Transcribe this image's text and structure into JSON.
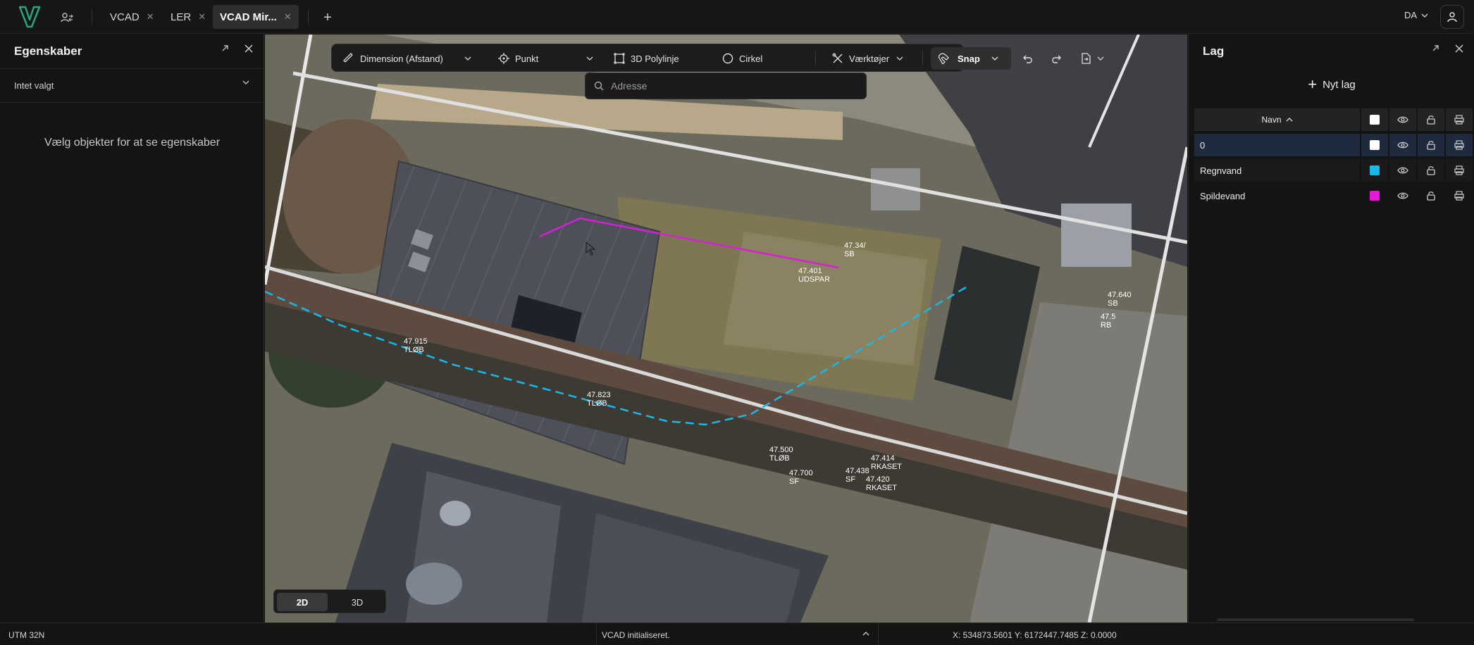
{
  "tabs": [
    {
      "label": "VCAD",
      "closable": true
    },
    {
      "label": "LER",
      "closable": true
    },
    {
      "label": "VCAD Mir...",
      "closable": true,
      "active": true
    }
  ],
  "language": "DA",
  "left_panel": {
    "title": "Egenskaber",
    "selection": "Intet valgt",
    "empty_message": "Vælg objekter for at se egenskaber"
  },
  "toolbar": {
    "dimension": "Dimension (Afstand)",
    "point": "Punkt",
    "polyline": "3D Polylinje",
    "circle": "Cirkel",
    "tools": "Værktøjer",
    "snap": "Snap"
  },
  "search": {
    "placeholder": "Adresse"
  },
  "view_toggle": {
    "btn_2d": "2D",
    "btn_3d": "3D",
    "active": "2D"
  },
  "map_labels": [
    {
      "value": "47.915",
      "code": "TLØB"
    },
    {
      "value": "47.823",
      "code": "TLØB"
    },
    {
      "value": "47.500",
      "code": "TLØB"
    },
    {
      "value": "47.700",
      "code": "SF"
    },
    {
      "value": "47.438",
      "code": "SF"
    },
    {
      "value": "47.414",
      "code": "RKASET"
    },
    {
      "value": "47.420",
      "code": "RKASET"
    },
    {
      "value": "47.401",
      "code": "UDSPAR"
    },
    {
      "value": "47.34/",
      "code": "SB"
    },
    {
      "value": "47.640",
      "code": "SB"
    },
    {
      "value": "47.5",
      "code": "RB"
    }
  ],
  "right_panel": {
    "title": "Lag",
    "new_layer": "Nyt lag",
    "column_name": "Navn",
    "layers": [
      {
        "name": "0",
        "color": "#ffffff",
        "selected": true
      },
      {
        "name": "Regnvand",
        "color": "#1ab8e8"
      },
      {
        "name": "Spildevand",
        "color": "#e619d6"
      }
    ]
  },
  "status_bar": {
    "crs": "UTM 32N",
    "message": "VCAD initialiseret.",
    "coords": "X: 534873.5601 Y: 6172447.7485 Z: 0.0000"
  },
  "colors": {
    "regnvand": "#1ab8e8",
    "spildevand": "#d61fd6",
    "accent": "#2aa67a"
  }
}
